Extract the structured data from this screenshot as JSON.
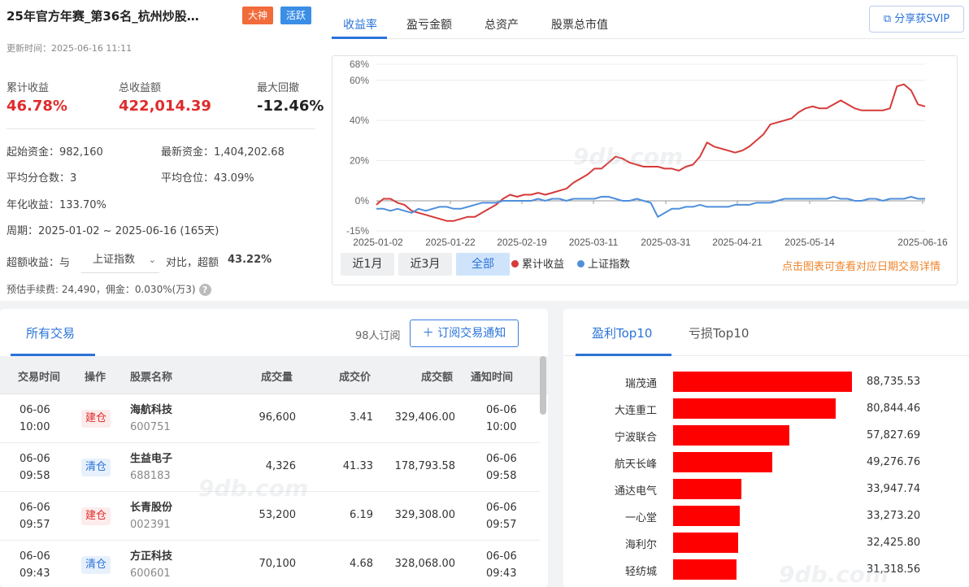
{
  "header": {
    "title": "25年官方年赛_第36名_杭州炒股…",
    "badges": [
      "大神",
      "活跃"
    ],
    "update_time": "更新时间：2025-06-16 11:11"
  },
  "kpis": [
    {
      "label": "累计收益",
      "value": "46.78%"
    },
    {
      "label": "总收益额",
      "value": "422,014.39"
    },
    {
      "label": "最大回撤",
      "value": "-12.46%"
    }
  ],
  "info": {
    "start_capital": "起始资金：982,160",
    "latest_capital": "最新资金：1,404,202.68",
    "avg_shares": "平均分仓数：3",
    "avg_position": "平均仓位：43.09%",
    "annual_return": "年化收益：133.70%",
    "period": "周期：2025-01-02 ~ 2025-06-16 (165天)",
    "excess_prefix": "超额收益：与",
    "excess_select": "上证指数",
    "excess_mid": "对比，超额",
    "excess_value": "43.22%",
    "fee": "预估手续费: 24,490，佣金：0.030%(万3)"
  },
  "chart_tabs": [
    "收益率",
    "盈亏金额",
    "总资产",
    "股票总市值"
  ],
  "share_button": "分享获SVIP",
  "range_buttons": [
    "近1月",
    "近3月",
    "全部"
  ],
  "legend": [
    "累计收益",
    "上证指数"
  ],
  "hint": "点击图表可查看对应日期交易详情",
  "watermark": "9db.com",
  "colors": {
    "series_red": "#d63a3a",
    "series_blue": "#4f8fdc"
  },
  "chart_data": {
    "type": "line",
    "y_tick_labels": [
      "68%",
      "60%",
      "40%",
      "20%",
      "0%",
      "-15%"
    ],
    "ylim": [
      -15,
      68
    ],
    "x_tick_labels": [
      "2025-01-02",
      "2025-01-22",
      "2025-02-19",
      "2025-03-11",
      "2025-03-31",
      "2025-04-21",
      "2025-05-14",
      "2025-06-16"
    ],
    "grid": true,
    "legend_position": "bottom-left",
    "series": [
      {
        "name": "累计收益",
        "color": "#d63a3a",
        "values": [
          -2,
          1,
          1,
          -1,
          -2,
          -5,
          -6,
          -7,
          -8,
          -9,
          -10,
          -10,
          -9,
          -8,
          -8,
          -6,
          -4,
          -2,
          1,
          3,
          2,
          3,
          3,
          4,
          3,
          4,
          5,
          6,
          9,
          11,
          13,
          16,
          16,
          19,
          22,
          21,
          19,
          18,
          17,
          17,
          17,
          16,
          16,
          15,
          17,
          18,
          22,
          29,
          27,
          26,
          25,
          24,
          25,
          27,
          30,
          33,
          38,
          39,
          40,
          41,
          44,
          46,
          47,
          46,
          46,
          48,
          50,
          48,
          46,
          45,
          45,
          45,
          45,
          46,
          57,
          58,
          55,
          48,
          47
        ]
      },
      {
        "name": "上证指数",
        "color": "#4f8fdc",
        "values": [
          -4,
          -4,
          -5,
          -4,
          -5,
          -6,
          -4,
          -5,
          -4,
          -3,
          -3,
          -4,
          -4,
          -3,
          -2,
          -1,
          -1,
          -1,
          0,
          0,
          0,
          0,
          0,
          1,
          0,
          1,
          1,
          0,
          1,
          1,
          1,
          1,
          2,
          2,
          1,
          0,
          0,
          1,
          0,
          -1,
          -8,
          -6,
          -4,
          -4,
          -3,
          -3,
          -2,
          -3,
          -3,
          -3,
          -3,
          -2,
          -2,
          -2,
          -1,
          -1,
          -1,
          0,
          1,
          1,
          1,
          1,
          1,
          1,
          1,
          2,
          1,
          1,
          0,
          0,
          1,
          1,
          0,
          1,
          1,
          1,
          2,
          1,
          1
        ]
      }
    ]
  },
  "trades": {
    "tab": "所有交易",
    "subscribers": "98人订阅",
    "subscribe_button": "＋ 订阅交易通知",
    "columns": [
      "交易时间",
      "操作",
      "股票名称",
      "成交量",
      "成交价",
      "成交额",
      "通知时间"
    ],
    "rows": [
      {
        "date": "06-06",
        "time": "10:00",
        "op": "建仓",
        "name": "海航科技",
        "code": "600751",
        "volume": "96,600",
        "price": "3.41",
        "amount": "329,406.00",
        "ndate": "06-06",
        "ntime": "10:00"
      },
      {
        "date": "06-06",
        "time": "09:58",
        "op": "清仓",
        "name": "生益电子",
        "code": "688183",
        "volume": "4,326",
        "price": "41.33",
        "amount": "178,793.58",
        "ndate": "06-06",
        "ntime": "09:58"
      },
      {
        "date": "06-06",
        "time": "09:57",
        "op": "建仓",
        "name": "长青股份",
        "code": "002391",
        "volume": "53,200",
        "price": "6.19",
        "amount": "329,308.00",
        "ndate": "06-06",
        "ntime": "09:57"
      },
      {
        "date": "06-06",
        "time": "09:43",
        "op": "清仓",
        "name": "方正科技",
        "code": "600601",
        "volume": "70,100",
        "price": "4.68",
        "amount": "328,068.00",
        "ndate": "06-06",
        "ntime": "09:43"
      }
    ]
  },
  "top10": {
    "tabs": [
      "盈利Top10",
      "亏损Top10"
    ],
    "items": [
      {
        "name": "瑞茂通",
        "value": "88,735.53",
        "num": 88735.53
      },
      {
        "name": "大连重工",
        "value": "80,844.46",
        "num": 80844.46
      },
      {
        "name": "宁波联合",
        "value": "57,827.69",
        "num": 57827.69
      },
      {
        "name": "航天长峰",
        "value": "49,276.76",
        "num": 49276.76
      },
      {
        "name": "通达电气",
        "value": "33,947.74",
        "num": 33947.74
      },
      {
        "name": "一心堂",
        "value": "33,273.20",
        "num": 33273.2
      },
      {
        "name": "海利尔",
        "value": "32,425.80",
        "num": 32425.8
      },
      {
        "name": "轻纺城",
        "value": "31,318.56",
        "num": 31318.56
      }
    ]
  }
}
